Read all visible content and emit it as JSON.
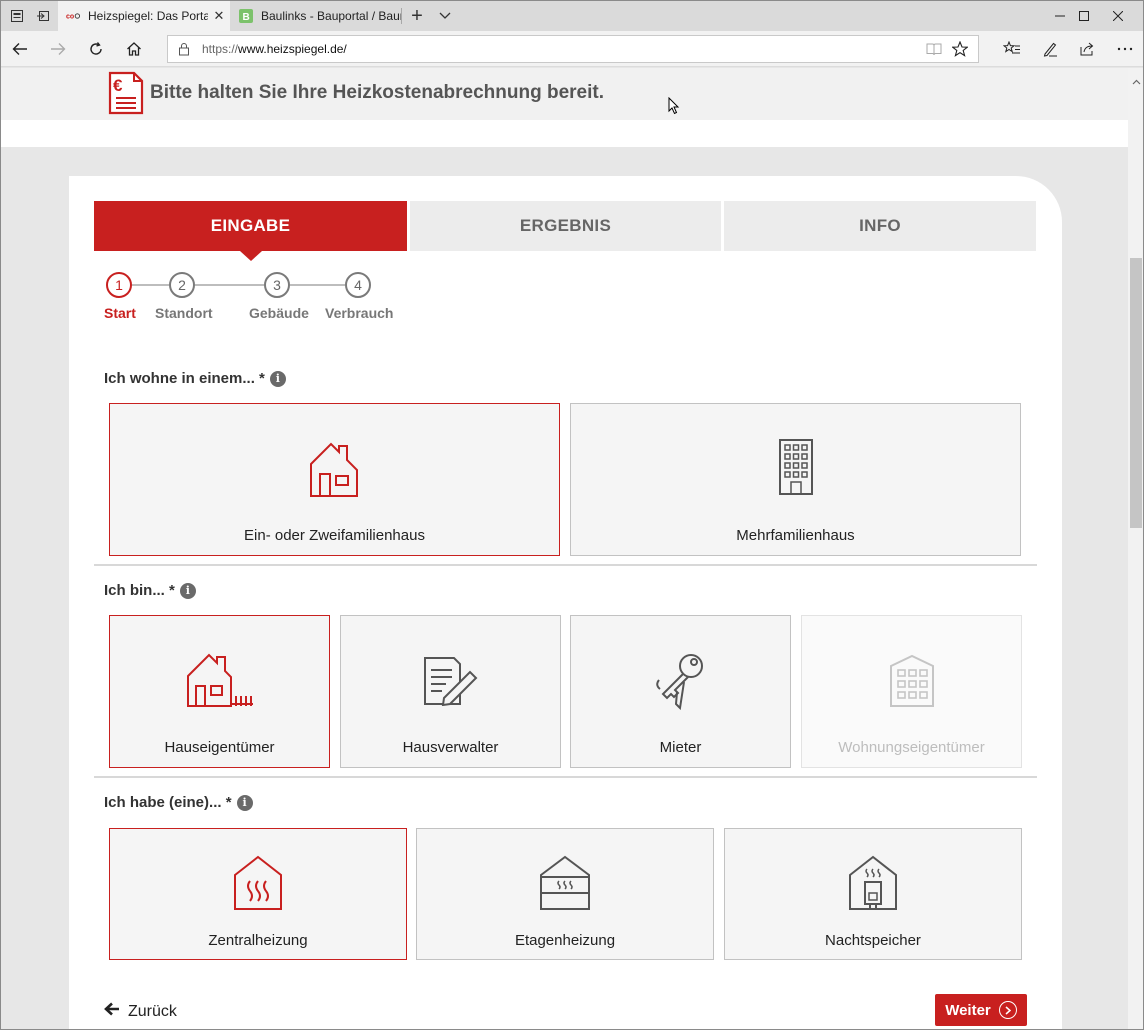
{
  "browser": {
    "tabs": [
      {
        "title": "Heizspiegel: Das Portal",
        "close": "✕",
        "favicon": "co2online-logo"
      },
      {
        "title": "Baulinks - Bauportal / Baum",
        "close": "✕",
        "favicon": "B"
      }
    ],
    "new_tab": "+",
    "url_prefix": "https://",
    "url_host": "www.heizspiegel.de/",
    "window_controls": [
      "minimize",
      "maximize",
      "close"
    ]
  },
  "notice": {
    "text": "Bitte halten Sie Ihre Heizkostenabrechnung bereit.",
    "icon": "euro-document-icon"
  },
  "main_tabs": [
    {
      "label": "EINGABE",
      "active": true
    },
    {
      "label": "ERGEBNIS",
      "active": false
    },
    {
      "label": "INFO",
      "active": false
    }
  ],
  "steps": [
    {
      "num": "1",
      "label": "Start",
      "active": true
    },
    {
      "num": "2",
      "label": "Standort",
      "active": false
    },
    {
      "num": "3",
      "label": "Gebäude",
      "active": false
    },
    {
      "num": "4",
      "label": "Verbrauch",
      "active": false
    }
  ],
  "sections": [
    {
      "label": "Ich wohne in einem... *",
      "info": "i",
      "options": [
        {
          "label": "Ein- oder Zweifamilienhaus",
          "icon": "house-icon",
          "selected": true
        },
        {
          "label": "Mehrfamilienhaus",
          "icon": "apartment-building-icon",
          "selected": false
        }
      ]
    },
    {
      "label": "Ich bin... *",
      "info": "i",
      "options": [
        {
          "label": "Hauseigentümer",
          "icon": "house-with-fence-icon",
          "selected": true
        },
        {
          "label": "Hausverwalter",
          "icon": "document-pen-icon",
          "selected": false
        },
        {
          "label": "Mieter",
          "icon": "keys-icon",
          "selected": false
        },
        {
          "label": "Wohnungseigentümer",
          "icon": "building-icon",
          "selected": false,
          "disabled": true
        }
      ]
    },
    {
      "label": "Ich habe (eine)... *",
      "info": "i",
      "options": [
        {
          "label": "Zentralheizung",
          "icon": "central-heating-icon",
          "selected": true
        },
        {
          "label": "Etagenheizung",
          "icon": "floor-heating-icon",
          "selected": false
        },
        {
          "label": "Nachtspeicher",
          "icon": "night-storage-icon",
          "selected": false
        }
      ]
    }
  ],
  "footer": {
    "back": "Zurück",
    "next": "Weiter"
  },
  "colors": {
    "accent": "#c8201f",
    "tab_inactive": "#ececec",
    "option_bg": "#f5f5f5"
  }
}
